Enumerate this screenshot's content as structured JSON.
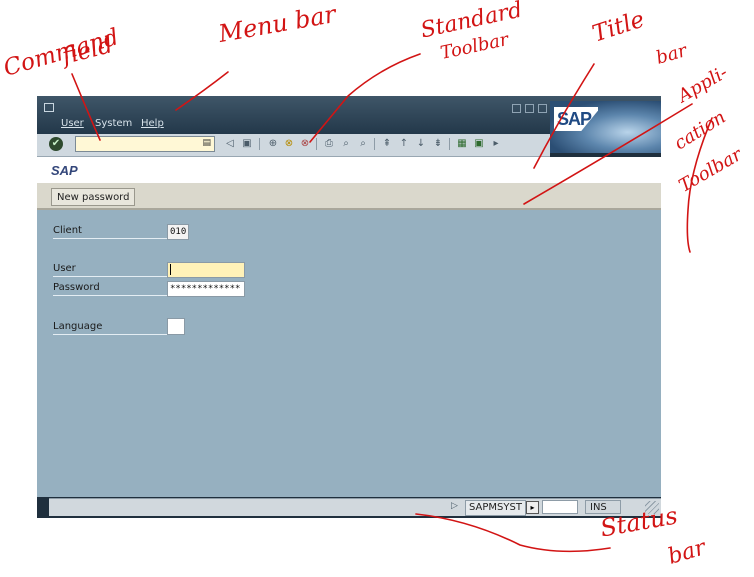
{
  "annotations": {
    "command_field": [
      "Command",
      "field"
    ],
    "menu_bar": "Menu bar",
    "standard_toolbar": [
      "Standard",
      "Toolbar"
    ],
    "title_bar": [
      "Title",
      "bar"
    ],
    "application_toolbar": [
      "Appli-",
      "cation",
      "Toolbar"
    ],
    "status_bar": [
      "Status",
      "bar"
    ]
  },
  "menubar": {
    "items": [
      "User",
      "System",
      "Help"
    ]
  },
  "logo": "SAP",
  "toolbar": {
    "icons": [
      "enter-icon",
      "back-icon",
      "save-icon",
      "back-nav-icon",
      "exit-icon",
      "cancel-icon",
      "print-icon",
      "find-icon",
      "find-next-icon",
      "first-page-icon",
      "previous-page-icon",
      "next-page-icon",
      "last-page-icon",
      "create-session-icon",
      "shortcut-icon",
      "help-icon"
    ]
  },
  "titlebar": {
    "title": "SAP"
  },
  "apptoolbar": {
    "new_password_label": "New password"
  },
  "form": {
    "client_label": "Client",
    "client_value": "010",
    "user_label": "User",
    "user_value": "",
    "password_label": "Password",
    "password_value": "*************",
    "language_label": "Language",
    "language_value": ""
  },
  "statusbar": {
    "system": "SAPMSYST",
    "mode": "INS"
  },
  "colors": {
    "annotation": "#d21414",
    "content_bg": "#96b0c0",
    "frame": "#1f2f3d"
  }
}
